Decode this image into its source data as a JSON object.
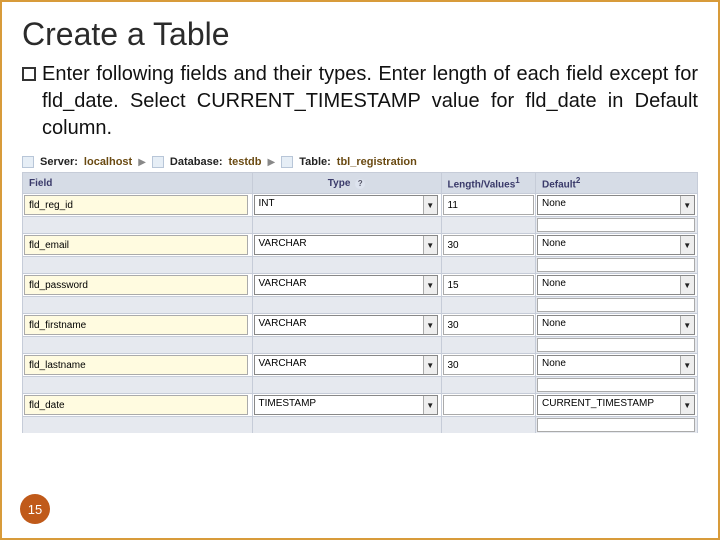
{
  "title": "Create a Table",
  "paragraph": "Enter following fields and their types. Enter length of each field except for fld_date. Select CURRENT_TIMESTAMP value for fld_date in Default column.",
  "breadcrumb": {
    "server_label": "Server:",
    "server_value": "localhost",
    "db_label": "Database:",
    "db_value": "testdb",
    "table_label": "Table:",
    "table_value": "tbl_registration"
  },
  "headers": {
    "field": "Field",
    "type": "Type",
    "len": "Length/Values",
    "def": "Default"
  },
  "rows": [
    {
      "field": "fld_reg_id",
      "type": "INT",
      "len": "11",
      "def": "None"
    },
    {
      "field": "fld_email",
      "type": "VARCHAR",
      "len": "30",
      "def": "None"
    },
    {
      "field": "fld_password",
      "type": "VARCHAR",
      "len": "15",
      "def": "None"
    },
    {
      "field": "fld_firstname",
      "type": "VARCHAR",
      "len": "30",
      "def": "None"
    },
    {
      "field": "fld_lastname",
      "type": "VARCHAR",
      "len": "30",
      "def": "None"
    },
    {
      "field": "fld_date",
      "type": "TIMESTAMP",
      "len": "",
      "def": "CURRENT_TIMESTAMP"
    }
  ],
  "page_number": "15",
  "chart_data": {
    "type": "table",
    "title": "phpMyAdmin table definition for tbl_registration",
    "columns": [
      "Field",
      "Type",
      "Length/Values",
      "Default"
    ],
    "rows": [
      [
        "fld_reg_id",
        "INT",
        11,
        "None"
      ],
      [
        "fld_email",
        "VARCHAR",
        30,
        "None"
      ],
      [
        "fld_password",
        "VARCHAR",
        15,
        "None"
      ],
      [
        "fld_firstname",
        "VARCHAR",
        30,
        "None"
      ],
      [
        "fld_lastname",
        "VARCHAR",
        30,
        "None"
      ],
      [
        "fld_date",
        "TIMESTAMP",
        null,
        "CURRENT_TIMESTAMP"
      ]
    ]
  }
}
